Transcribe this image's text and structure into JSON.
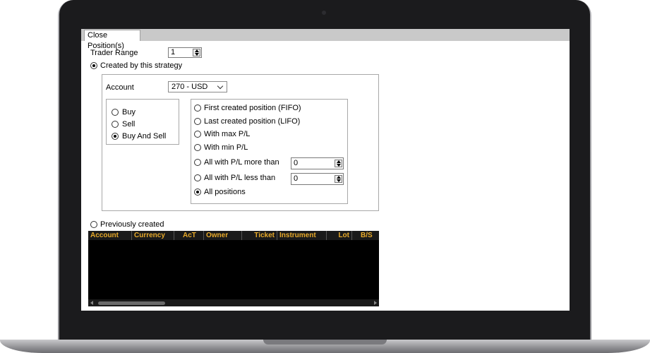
{
  "tab": {
    "label": "Close Position(s)"
  },
  "trader_range": {
    "label": "Trader Range",
    "value": "1"
  },
  "created_by_strategy": {
    "label": "Created by this strategy",
    "checked": true
  },
  "account": {
    "label": "Account",
    "value": "270 - USD"
  },
  "side_options": [
    {
      "label": "Buy",
      "checked": false
    },
    {
      "label": "Sell",
      "checked": false
    },
    {
      "label": "Buy And Sell",
      "checked": true
    }
  ],
  "position_options": [
    {
      "label": "First created position (FIFO)",
      "checked": false
    },
    {
      "label": "Last created position (LIFO)",
      "checked": false
    },
    {
      "label": "With max P/L",
      "checked": false
    },
    {
      "label": "With min P/L",
      "checked": false
    },
    {
      "label": "All with P/L more than",
      "checked": false,
      "value": "0"
    },
    {
      "label": "All with P/L less than",
      "checked": false,
      "value": "0"
    },
    {
      "label": "All positions",
      "checked": true
    }
  ],
  "previously_created": {
    "label": "Previously created",
    "checked": false
  },
  "grid": {
    "columns": [
      "Account",
      "Currency",
      "AcT",
      "Owner",
      "Ticket",
      "Instrument",
      "Lot",
      "B/S"
    ]
  },
  "colors": {
    "header_text": "#e7a92a",
    "grid_bg": "#000000"
  }
}
